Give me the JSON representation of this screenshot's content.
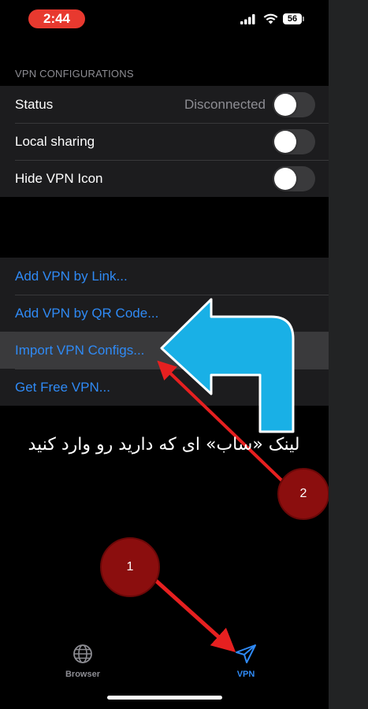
{
  "status_bar": {
    "time": "2:44",
    "battery": "56"
  },
  "section_header": "VPN CONFIGURATIONS",
  "settings": [
    {
      "label": "Status",
      "value": "Disconnected",
      "toggle_on": false
    },
    {
      "label": "Local sharing",
      "toggle_on": false
    },
    {
      "label": "Hide VPN Icon",
      "toggle_on": false
    }
  ],
  "actions": [
    {
      "label": "Add VPN by Link..."
    },
    {
      "label": "Add VPN by QR Code..."
    },
    {
      "label": "Import VPN Configs..."
    },
    {
      "label": "Get Free VPN..."
    }
  ],
  "annotation": {
    "caption": "لینک «ساب» ای که دارید رو وارد کنید",
    "badge_1": "1",
    "badge_2": "2"
  },
  "tabbar": {
    "browser_label": "Browser",
    "vpn_label": "VPN",
    "selected": "VPN"
  },
  "colors": {
    "accent": "#2f8af5",
    "status_time_bg": "#e8392f",
    "arrow_blue": "#19b0e6",
    "annotation_red": "#e62020",
    "badge_red": "#8b0e0e"
  },
  "icons": [
    "signal-icon",
    "wifi-icon",
    "battery-icon",
    "globe-icon",
    "send-icon"
  ]
}
